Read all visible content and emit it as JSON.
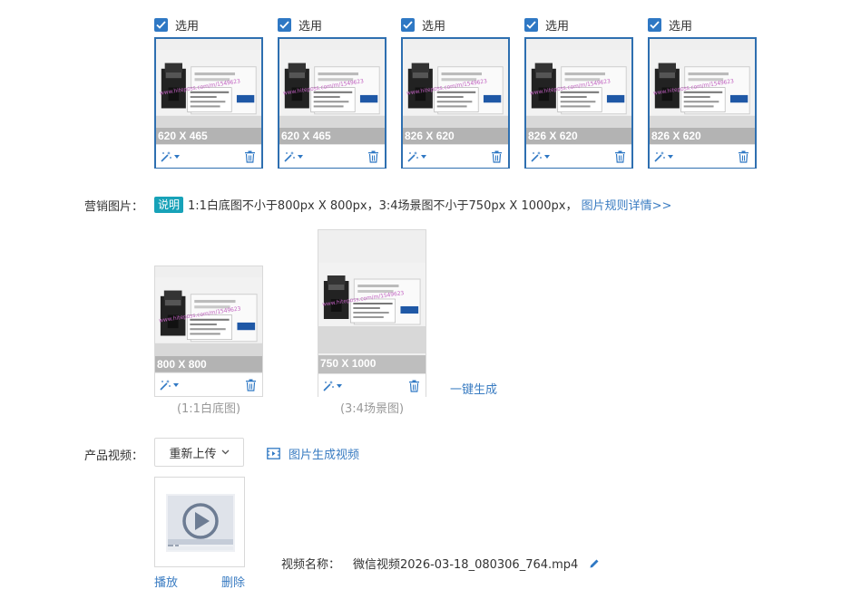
{
  "top_images": [
    {
      "select_label": "选用",
      "checked": true,
      "dims": "620 X 465"
    },
    {
      "select_label": "选用",
      "checked": true,
      "dims": "620 X 465"
    },
    {
      "select_label": "选用",
      "checked": true,
      "dims": "826 X 620"
    },
    {
      "select_label": "选用",
      "checked": true,
      "dims": "826 X 620"
    },
    {
      "select_label": "选用",
      "checked": true,
      "dims": "826 X 620"
    }
  ],
  "marketing": {
    "label": "营销图片：",
    "badge": "说明",
    "note": "1:1白底图不小于800px X 800px，3:4场景图不小于750px X 1000px，",
    "rules_link": "图片规则详情>>",
    "images": [
      {
        "dims": "800 X 800",
        "caption": "(1:1白底图)"
      },
      {
        "dims": "750 X 1000",
        "caption": "(3:4场景图)"
      }
    ],
    "generate_link": "一键生成"
  },
  "video": {
    "label": "产品视频：",
    "reupload_button": "重新上传",
    "generate_from_images": "图片生成视频",
    "play_link": "播放",
    "delete_link": "删除",
    "name_label": "视频名称：",
    "file_name": "微信视频2026-03-18_080306_764.mp4"
  },
  "colors": {
    "accent": "#2f78c4",
    "badge": "#17a2b8",
    "link": "#3a7cc2"
  }
}
